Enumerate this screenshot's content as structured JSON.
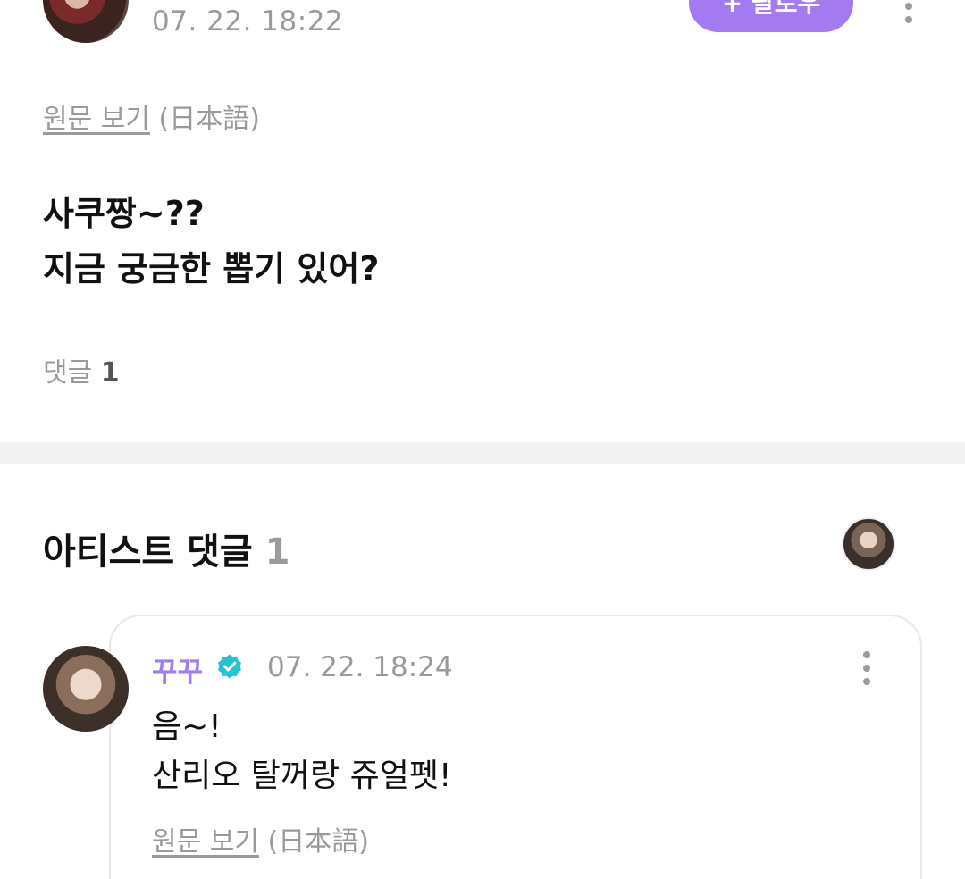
{
  "post": {
    "date": "07. 22. 18:22",
    "follow_label": "+ 팔로우",
    "translate_link": "원문 보기",
    "translate_lang": "(日本語)",
    "body_lines": [
      "사쿠짱~??",
      "지금 궁금한 뽑기 있어?"
    ],
    "comment_label": "댓글",
    "comment_count": "1"
  },
  "artist_comments": {
    "title": "아티스트 댓글",
    "count": "1",
    "items": [
      {
        "name": "꾸꾸",
        "verified": true,
        "date": "07. 22. 18:24",
        "body_lines": [
          "음~!",
          "산리오 탈꺼랑 쥬얼펫!"
        ],
        "translate_link": "원문 보기",
        "translate_lang": "(日本語)"
      }
    ]
  },
  "colors": {
    "accent": "#a47af0",
    "verified": "#22c3d6",
    "muted": "#9a9a9a"
  },
  "icons": [
    "more-vertical-icon",
    "verified-badge-icon"
  ]
}
